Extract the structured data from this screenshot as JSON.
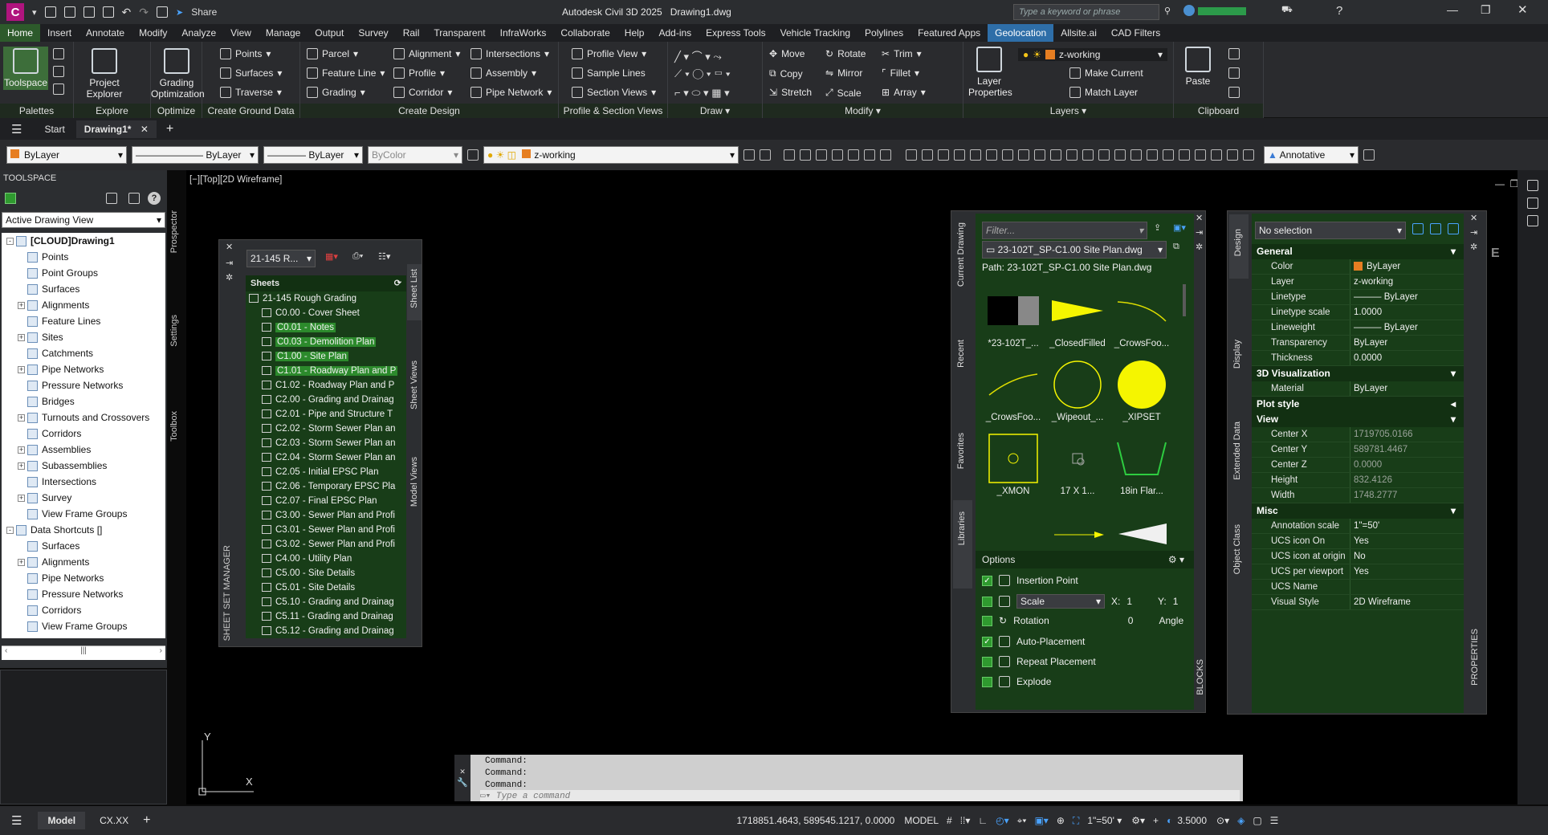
{
  "title_bar": {
    "logo": "C",
    "share": "Share",
    "title": "Autodesk Civil 3D 2025",
    "document": "Drawing1.dwg",
    "search_placeholder": "Type a keyword or phrase"
  },
  "ribbon_tabs": [
    "Home",
    "Insert",
    "Annotate",
    "Modify",
    "Analyze",
    "View",
    "Manage",
    "Output",
    "Survey",
    "Rail",
    "Transparent",
    "InfraWorks",
    "Collaborate",
    "Help",
    "Add-ins",
    "Express Tools",
    "Vehicle Tracking",
    "Polylines",
    "Featured Apps",
    "Geolocation",
    "Allsite.ai",
    "CAD Filters"
  ],
  "ribbon": {
    "toolspace": "Toolspace",
    "project_explorer": "Project Explorer",
    "grading_optimization": "Grading Optimization",
    "ground": [
      "Points",
      "Surfaces",
      "Traverse"
    ],
    "design_col1": [
      "Parcel",
      "Feature Line",
      "Grading"
    ],
    "design_col2": [
      "Alignment",
      "Profile",
      "Corridor"
    ],
    "design_col3": [
      "Intersections",
      "Assembly",
      "Pipe Network"
    ],
    "profile_section": [
      "Profile View",
      "Sample Lines",
      "Section Views"
    ],
    "modify_col1": [
      "Move",
      "Copy",
      "Stretch"
    ],
    "modify_col2": [
      "Rotate",
      "Mirror",
      "Scale"
    ],
    "modify_col3": [
      "Trim",
      "Fillet",
      "Array"
    ],
    "layer_properties": "Layer Properties",
    "layer_current": "z-working",
    "make_current": "Make Current",
    "match_layer": "Match Layer",
    "paste": "Paste",
    "panel_titles": [
      "Palettes",
      "Explore",
      "Optimize",
      "Create Ground Data",
      "Create Design",
      "Profile & Section Views",
      "Draw",
      "Modify",
      "Layers",
      "Clipboard"
    ]
  },
  "doc_tabs": {
    "start": "Start",
    "drawing": "Drawing1*"
  },
  "props_bar": {
    "color": "ByLayer",
    "linetype": "ByLayer",
    "lineweight": "ByLayer",
    "plotstyle": "ByColor",
    "layer": "z-working",
    "annotative": "Annotative"
  },
  "toolspace": {
    "title": "TOOLSPACE",
    "view": "Active Drawing View",
    "tabs": [
      "Prospector",
      "Settings",
      "Toolbox"
    ],
    "tree": [
      {
        "label": "[CLOUD]Drawing1",
        "level": 0,
        "exp": "-",
        "bold": true
      },
      {
        "label": "Points",
        "level": 1,
        "exp": ""
      },
      {
        "label": "Point Groups",
        "level": 1,
        "exp": ""
      },
      {
        "label": "Surfaces",
        "level": 1,
        "exp": ""
      },
      {
        "label": "Alignments",
        "level": 1,
        "exp": "+"
      },
      {
        "label": "Feature Lines",
        "level": 1,
        "exp": ""
      },
      {
        "label": "Sites",
        "level": 1,
        "exp": "+"
      },
      {
        "label": "Catchments",
        "level": 1,
        "exp": ""
      },
      {
        "label": "Pipe Networks",
        "level": 1,
        "exp": "+"
      },
      {
        "label": "Pressure Networks",
        "level": 1,
        "exp": ""
      },
      {
        "label": "Bridges",
        "level": 1,
        "exp": ""
      },
      {
        "label": "Turnouts and Crossovers",
        "level": 1,
        "exp": "+"
      },
      {
        "label": "Corridors",
        "level": 1,
        "exp": ""
      },
      {
        "label": "Assemblies",
        "level": 1,
        "exp": "+"
      },
      {
        "label": "Subassemblies",
        "level": 1,
        "exp": "+"
      },
      {
        "label": "Intersections",
        "level": 1,
        "exp": ""
      },
      {
        "label": "Survey",
        "level": 1,
        "exp": "+"
      },
      {
        "label": "View Frame Groups",
        "level": 1,
        "exp": ""
      },
      {
        "label": "Data Shortcuts []",
        "level": 0,
        "exp": "-"
      },
      {
        "label": "Surfaces",
        "level": 1,
        "exp": ""
      },
      {
        "label": "Alignments",
        "level": 1,
        "exp": "+"
      },
      {
        "label": "Pipe Networks",
        "level": 1,
        "exp": ""
      },
      {
        "label": "Pressure Networks",
        "level": 1,
        "exp": ""
      },
      {
        "label": "Corridors",
        "level": 1,
        "exp": ""
      },
      {
        "label": "View Frame Groups",
        "level": 1,
        "exp": ""
      }
    ]
  },
  "viewport_label": "[−][Top][2D Wireframe]",
  "sheet_set": {
    "dropdown": "21-145 R...",
    "header": "Sheets",
    "root": "21-145 Rough Grading",
    "side_title": "SHEET SET MANAGER",
    "tabs": [
      "Sheet List",
      "Sheet Views",
      "Model Views"
    ],
    "sheets": [
      {
        "label": "C0.00 - Cover Sheet",
        "sel": false
      },
      {
        "label": "C0.01 - Notes",
        "sel": true
      },
      {
        "label": "C0.03 - Demolition Plan",
        "sel": true
      },
      {
        "label": "C1.00 - Site Plan",
        "sel": true
      },
      {
        "label": "C1.01 - Roadway Plan and P",
        "sel": true
      },
      {
        "label": "C1.02 - Roadway Plan and P",
        "sel": false
      },
      {
        "label": "C2.00 - Grading and Drainag",
        "sel": false
      },
      {
        "label": "C2.01 - Pipe and Structure T",
        "sel": false
      },
      {
        "label": "C2.02 - Storm Sewer Plan an",
        "sel": false
      },
      {
        "label": "C2.03 - Storm Sewer Plan an",
        "sel": false
      },
      {
        "label": "C2.04 - Storm Sewer Plan an",
        "sel": false
      },
      {
        "label": "C2.05 - Initial EPSC Plan",
        "sel": false
      },
      {
        "label": "C2.06 - Temporary EPSC Pla",
        "sel": false
      },
      {
        "label": "C2.07 - Final EPSC Plan",
        "sel": false
      },
      {
        "label": "C3.00 - Sewer Plan and Profi",
        "sel": false
      },
      {
        "label": "C3.01 - Sewer Plan and Profi",
        "sel": false
      },
      {
        "label": "C3.02 - Sewer Plan and Profi",
        "sel": false
      },
      {
        "label": "C4.00 - Utility Plan",
        "sel": false
      },
      {
        "label": "C5.00 - Site Details",
        "sel": false
      },
      {
        "label": "C5.01 - Site Details",
        "sel": false
      },
      {
        "label": "C5.10 - Grading and Drainag",
        "sel": false
      },
      {
        "label": "C5.11 - Grading and Drainag",
        "sel": false
      },
      {
        "label": "C5.12 - Grading and Drainag",
        "sel": false
      }
    ]
  },
  "blocks": {
    "filter_placeholder": "Filter...",
    "file": "23-102T_SP-C1.00 Site Plan.dwg",
    "path": "Path: 23-102T_SP-C1.00 Site Plan.dwg",
    "side_tabs": [
      "Current Drawing",
      "Recent",
      "Favorites",
      "Libraries"
    ],
    "side_title": "BLOCKS",
    "items": [
      "*23-102T_...",
      "_ClosedFilled",
      "_CrowsFoo...",
      "_CrowsFoo...",
      "_Wipeout_...",
      "_XIPSET",
      "_XMON",
      "17 X 1...",
      "18in Flar..."
    ],
    "options_title": "Options",
    "insertion_point": "Insertion Point",
    "scale": "Scale",
    "x_label": "X:",
    "x_val": "1",
    "y_label": "Y:",
    "y_val": "1",
    "rotation": "Rotation",
    "rotation_val": "0",
    "angle": "Angle",
    "auto_placement": "Auto-Placement",
    "repeat_placement": "Repeat Placement",
    "explode": "Explode"
  },
  "properties": {
    "selection": "No selection",
    "side_tabs": [
      "Design",
      "Display",
      "Extended Data",
      "Object Class"
    ],
    "side_title": "PROPERTIES",
    "sections": [
      {
        "title": "General",
        "rows": [
          [
            "Color",
            "ByLayer"
          ],
          [
            "Layer",
            "z-working"
          ],
          [
            "Linetype",
            "——— ByLayer"
          ],
          [
            "Linetype scale",
            "1.0000"
          ],
          [
            "Lineweight",
            "——— ByLayer"
          ],
          [
            "Transparency",
            "ByLayer"
          ],
          [
            "Thickness",
            "0.0000"
          ]
        ]
      },
      {
        "title": "3D Visualization",
        "rows": [
          [
            "Material",
            "ByLayer"
          ]
        ]
      },
      {
        "title": "Plot style",
        "rows": []
      },
      {
        "title": "View",
        "rows": [
          [
            "Center X",
            "1719705.0166"
          ],
          [
            "Center Y",
            "589781.4467"
          ],
          [
            "Center Z",
            "0.0000"
          ],
          [
            "Height",
            "832.4126"
          ],
          [
            "Width",
            "1748.2777"
          ]
        ]
      },
      {
        "title": "Misc",
        "rows": [
          [
            "Annotation scale",
            "1\"=50'"
          ],
          [
            "UCS icon On",
            "Yes"
          ],
          [
            "UCS icon at origin",
            "No"
          ],
          [
            "UCS per viewport",
            "Yes"
          ],
          [
            "UCS Name",
            ""
          ],
          [
            "Visual Style",
            "2D Wireframe"
          ]
        ]
      }
    ]
  },
  "command": {
    "history": [
      "Command:",
      "Command:",
      "Command:"
    ],
    "placeholder": "Type a command"
  },
  "status": {
    "model_tab": "Model",
    "layout_tab": "CX.XX",
    "coords": "1718851.4643, 589545.1217, 0.0000",
    "model": "MODEL",
    "scale": "1\"=50'",
    "value": "3.5000"
  },
  "ucs": {
    "x": "X",
    "y": "Y"
  },
  "colors": {
    "accent_green": "#183d18",
    "selection": "#2c8a2c",
    "geolocation_tab": "#2e6ea8",
    "home_tab": "#2d5a2b"
  }
}
